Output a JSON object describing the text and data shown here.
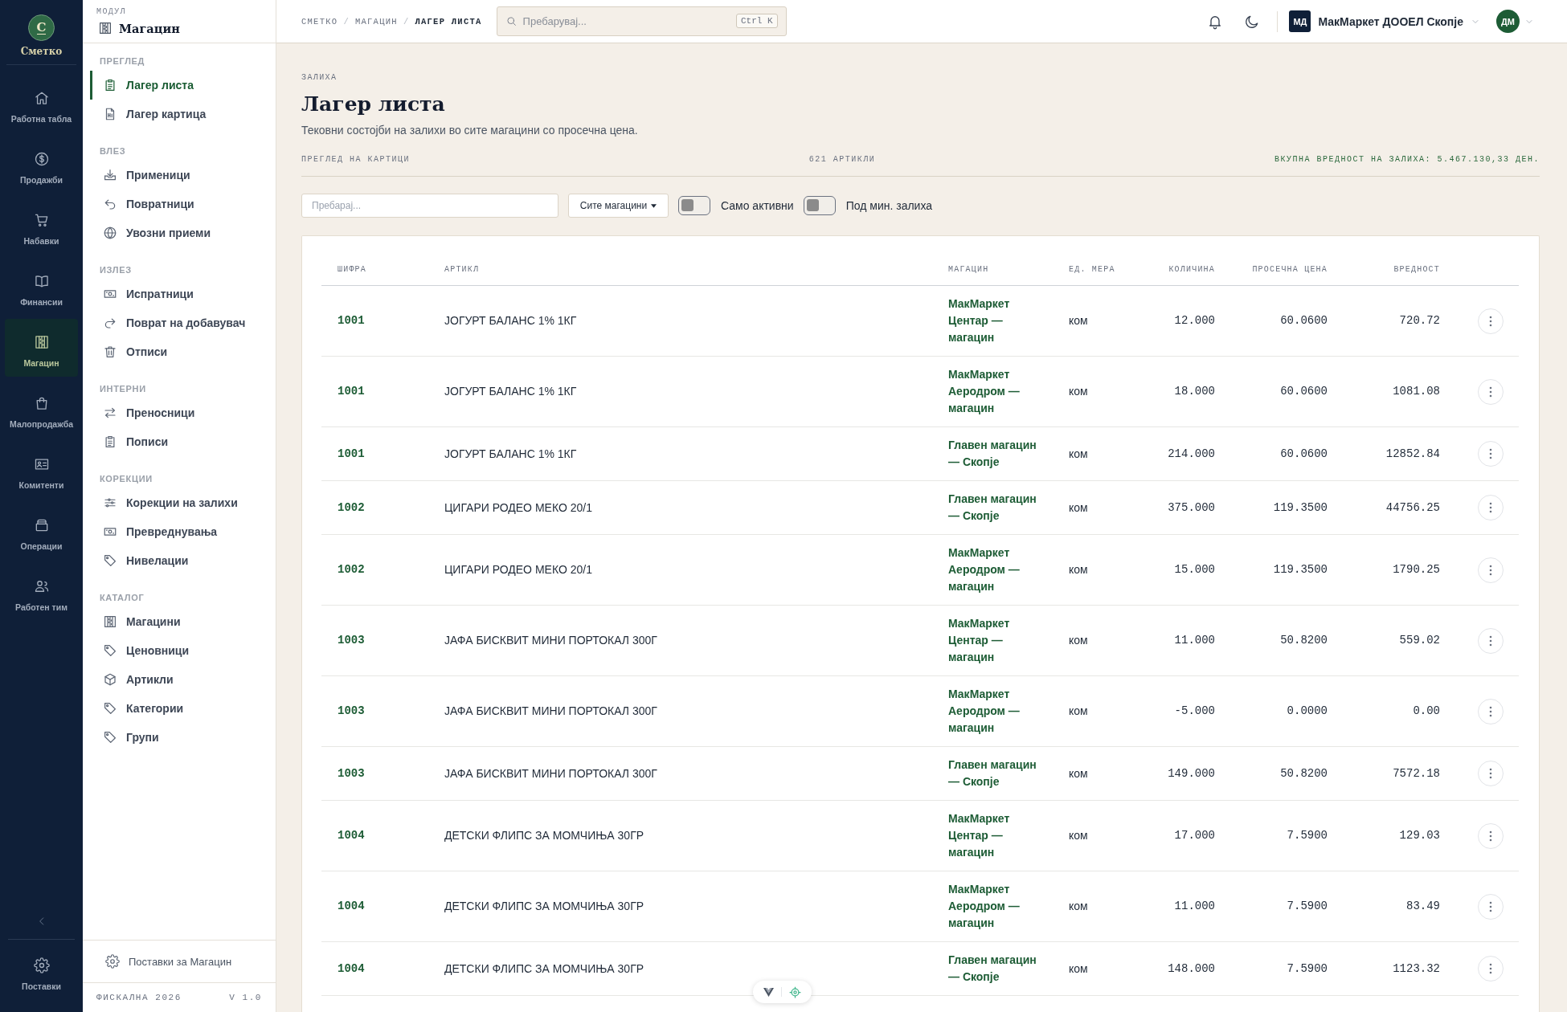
{
  "rail": {
    "logo": {
      "letter": "С",
      "name": "Сметко"
    },
    "items": [
      {
        "label": "Работна табла",
        "selected": false
      },
      {
        "label": "Продажби",
        "selected": false
      },
      {
        "label": "Набавки",
        "selected": false
      },
      {
        "label": "Финансии",
        "selected": false
      },
      {
        "label": "Магацин",
        "selected": true
      },
      {
        "label": "Малопродажба",
        "selected": false
      },
      {
        "label": "Комитенти",
        "selected": false
      },
      {
        "label": "Операции",
        "selected": false
      },
      {
        "label": "Работен тим",
        "selected": false
      }
    ],
    "settings": {
      "label": "Поставки"
    }
  },
  "sidebar": {
    "caption": "МОДУЛ",
    "title": "Магацин",
    "sections": [
      {
        "heading": "ПРЕГЛЕД",
        "items": [
          {
            "label": "Лагер листа",
            "selected": true
          },
          {
            "label": "Лагер картица",
            "selected": false
          }
        ]
      },
      {
        "heading": "ВЛЕЗ",
        "items": [
          {
            "label": "Применици",
            "selected": false
          },
          {
            "label": "Повратници",
            "selected": false
          },
          {
            "label": "Увозни приеми",
            "selected": false
          }
        ]
      },
      {
        "heading": "ИЗЛЕЗ",
        "items": [
          {
            "label": "Испратници",
            "selected": false
          },
          {
            "label": "Поврат на добавувач",
            "selected": false
          },
          {
            "label": "Отписи",
            "selected": false
          }
        ]
      },
      {
        "heading": "ИНТЕРНИ",
        "items": [
          {
            "label": "Преносници",
            "selected": false
          },
          {
            "label": "Пописи",
            "selected": false
          }
        ]
      },
      {
        "heading": "КОРЕКЦИИ",
        "items": [
          {
            "label": "Корекции на залихи",
            "selected": false
          },
          {
            "label": "Превреднувања",
            "selected": false
          },
          {
            "label": "Нивелации",
            "selected": false
          }
        ]
      },
      {
        "heading": "КАТАЛОГ",
        "items": [
          {
            "label": "Магацини",
            "selected": false
          },
          {
            "label": "Ценовници",
            "selected": false
          },
          {
            "label": "Артикли",
            "selected": false
          },
          {
            "label": "Категории",
            "selected": false
          },
          {
            "label": "Групи",
            "selected": false
          }
        ]
      }
    ],
    "settings_link": "Поставки за Магацин",
    "footer": {
      "edition": "ФИСКАЛНА 2026",
      "version": "V 1.0"
    }
  },
  "topbar": {
    "breadcrumb": [
      {
        "label": "СМЕТКО",
        "current": false
      },
      {
        "label": "МАГАЦИН",
        "current": false
      },
      {
        "label": "ЛАГЕР ЛИСТА",
        "current": true
      }
    ],
    "separators": [
      "/",
      "/"
    ],
    "search": {
      "placeholder": "Пребарувај...",
      "shortcut": "Ctrl K"
    },
    "company": {
      "initials": "МД",
      "name": "МакМаркет ДООЕЛ Скопје"
    },
    "user": {
      "initials": "ДМ"
    }
  },
  "page": {
    "eyebrow": "ЗАЛИХА",
    "title": "Лагер листа",
    "subtitle": "Тековни состојби на залихи во сите магацини со просечна цена.",
    "summary": {
      "view": "ПРЕГЛЕД НА КАРТИЦИ",
      "count": "621 АРТИКЛИ",
      "total": "ВКУПНА ВРЕДНОСТ НА ЗАЛИХА: 5.467.130,33 ДЕН."
    }
  },
  "filters": {
    "search": {
      "placeholder": "Пребарај..."
    },
    "store_select": {
      "value": "Сите магацини"
    },
    "toggles": [
      {
        "label": "Само активни",
        "on": false
      },
      {
        "label": "Под мин. залиха",
        "on": false
      }
    ]
  },
  "table": {
    "columns": [
      "ШИФРА",
      "АРТИКЛ",
      "МАГАЦИН",
      "ЕД. МЕРА",
      "КОЛИЧИНА",
      "ПРОСЕЧНА ЦЕНА",
      "ВРЕДНОСТ"
    ],
    "rows": [
      {
        "code": "1001",
        "article": "ЈОГУРТ БАЛАНС 1% 1КГ",
        "store": "МакМаркет Центар — магацин",
        "unit": "ком",
        "quantity": "12.000",
        "avg_price": "60.0600",
        "value": "720.72"
      },
      {
        "code": "1001",
        "article": "ЈОГУРТ БАЛАНС 1% 1КГ",
        "store": "МакМаркет Аеродром — магацин",
        "unit": "ком",
        "quantity": "18.000",
        "avg_price": "60.0600",
        "value": "1081.08"
      },
      {
        "code": "1001",
        "article": "ЈОГУРТ БАЛАНС 1% 1КГ",
        "store": "Главен магацин — Скопје",
        "unit": "ком",
        "quantity": "214.000",
        "avg_price": "60.0600",
        "value": "12852.84"
      },
      {
        "code": "1002",
        "article": "ЦИГАРИ РОДЕО МЕКО 20/1",
        "store": "Главен магацин — Скопје",
        "unit": "ком",
        "quantity": "375.000",
        "avg_price": "119.3500",
        "value": "44756.25"
      },
      {
        "code": "1002",
        "article": "ЦИГАРИ РОДЕО МЕКО 20/1",
        "store": "МакМаркет Аеродром — магацин",
        "unit": "ком",
        "quantity": "15.000",
        "avg_price": "119.3500",
        "value": "1790.25"
      },
      {
        "code": "1003",
        "article": "ЈАФА БИСКВИТ МИНИ ПОРТОКАЛ 300Г",
        "store": "МакМаркет Центар — магацин",
        "unit": "ком",
        "quantity": "11.000",
        "avg_price": "50.8200",
        "value": "559.02"
      },
      {
        "code": "1003",
        "article": "ЈАФА БИСКВИТ МИНИ ПОРТОКАЛ 300Г",
        "store": "МакМаркет Аеродром — магацин",
        "unit": "ком",
        "quantity": "-5.000",
        "avg_price": "0.0000",
        "value": "0.00"
      },
      {
        "code": "1003",
        "article": "ЈАФА БИСКВИТ МИНИ ПОРТОКАЛ 300Г",
        "store": "Главен магацин — Скопје",
        "unit": "ком",
        "quantity": "149.000",
        "avg_price": "50.8200",
        "value": "7572.18"
      },
      {
        "code": "1004",
        "article": "ДЕТСКИ ФЛИПС ЗА МОМЧИЊА 30ГР",
        "store": "МакМаркет Центар — магацин",
        "unit": "ком",
        "quantity": "17.000",
        "avg_price": "7.5900",
        "value": "129.03"
      },
      {
        "code": "1004",
        "article": "ДЕТСКИ ФЛИПС ЗА МОМЧИЊА 30ГР",
        "store": "МакМаркет Аеродром — магацин",
        "unit": "ком",
        "quantity": "11.000",
        "avg_price": "7.5900",
        "value": "83.49"
      },
      {
        "code": "1004",
        "article": "ДЕТСКИ ФЛИПС ЗА МОМЧИЊА 30ГР",
        "store": "Главен магацин — Скопје",
        "unit": "ком",
        "quantity": "148.000",
        "avg_price": "7.5900",
        "value": "1123.32"
      }
    ]
  }
}
